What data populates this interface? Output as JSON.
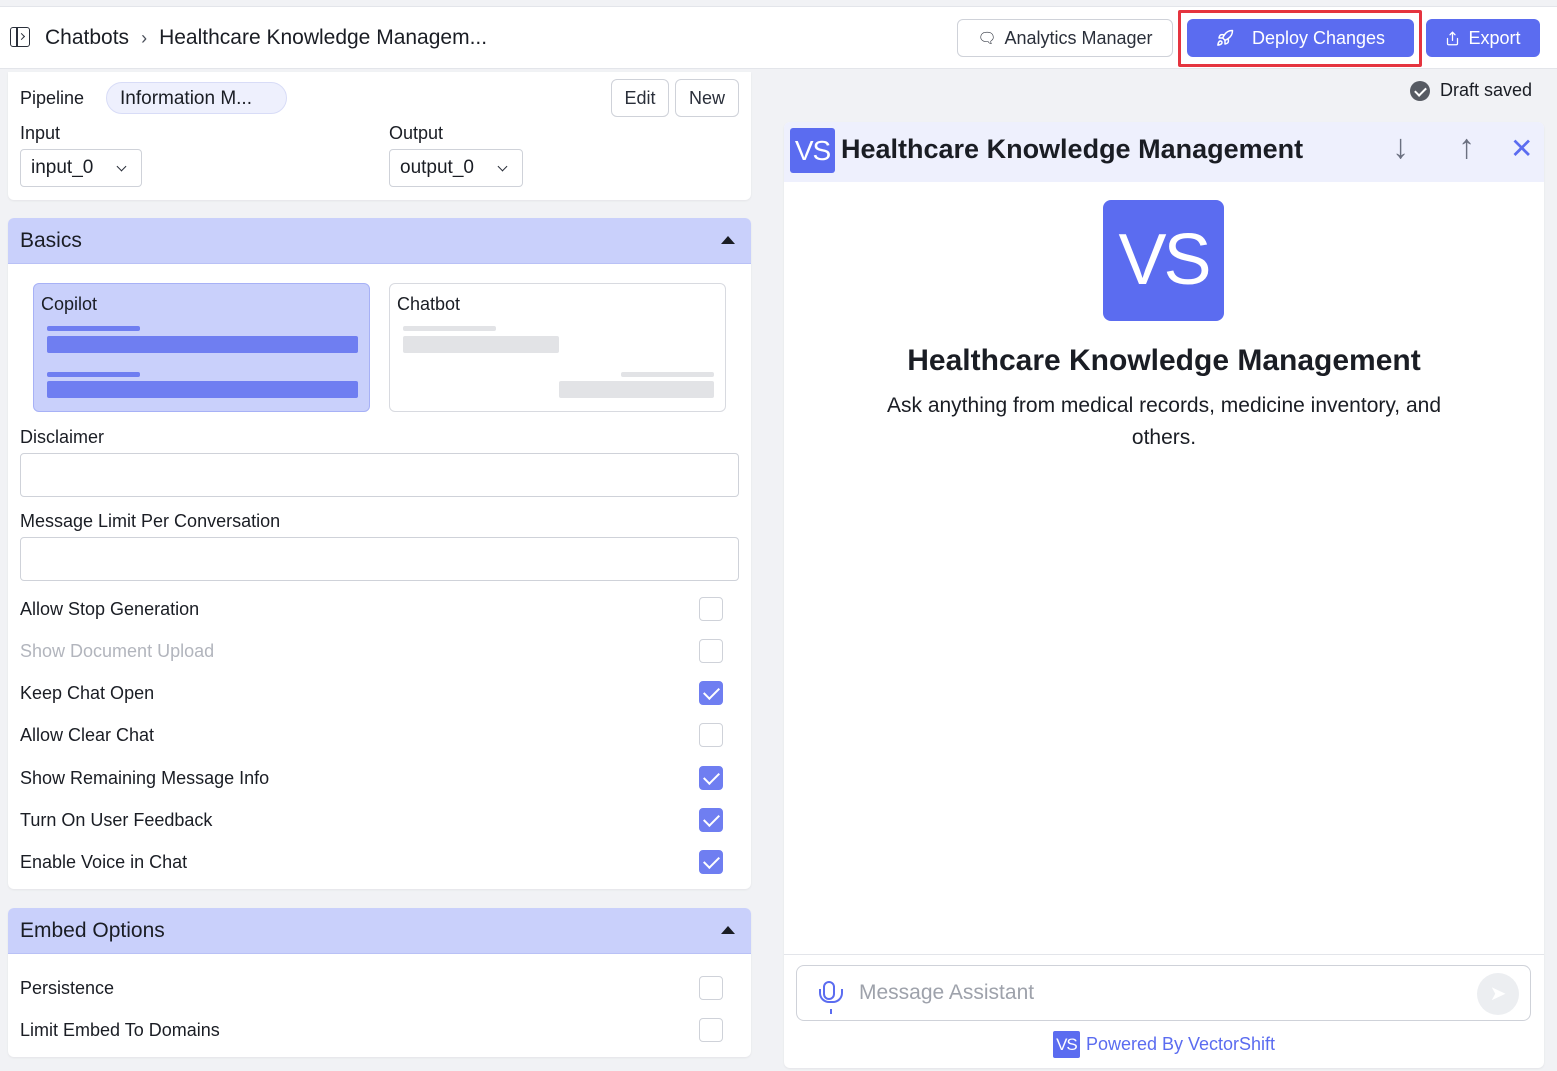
{
  "header": {
    "breadcrumb_root": "Chatbots",
    "breadcrumb_separator": "›",
    "breadcrumb_current": "Healthcare Knowledge Managem...",
    "analytics_label": "Analytics Manager",
    "deploy_label": "Deploy Changes",
    "export_label": "Export"
  },
  "pipeline": {
    "label": "Pipeline",
    "value": "Information M...",
    "edit_label": "Edit",
    "new_label": "New",
    "input_label": "Input",
    "input_value": "input_0",
    "output_label": "Output",
    "output_value": "output_0"
  },
  "basics": {
    "title": "Basics",
    "modes": [
      {
        "label": "Copilot",
        "selected": true
      },
      {
        "label": "Chatbot",
        "selected": false
      }
    ],
    "disclaimer_label": "Disclaimer",
    "disclaimer_value": "",
    "message_limit_label": "Message Limit Per Conversation",
    "message_limit_value": "",
    "options": [
      {
        "label": "Allow Stop Generation",
        "checked": false,
        "disabled": false
      },
      {
        "label": "Show Document Upload",
        "checked": false,
        "disabled": true
      },
      {
        "label": "Keep Chat Open",
        "checked": true,
        "disabled": false
      },
      {
        "label": "Allow Clear Chat",
        "checked": false,
        "disabled": false
      },
      {
        "label": "Show Remaining Message Info",
        "checked": true,
        "disabled": false
      },
      {
        "label": "Turn On User Feedback",
        "checked": true,
        "disabled": false
      },
      {
        "label": "Enable Voice in Chat",
        "checked": true,
        "disabled": false
      }
    ]
  },
  "embed": {
    "title": "Embed Options",
    "options": [
      {
        "label": "Persistence",
        "checked": false
      },
      {
        "label": "Limit Embed To Domains",
        "checked": false
      }
    ]
  },
  "status": {
    "draft_text": "Draft saved"
  },
  "chat": {
    "logo_text": "VS",
    "title": "Healthcare Knowledge Management",
    "welcome_title": "Healthcare Knowledge Management",
    "welcome_subtitle": "Ask anything from medical records, medicine inventory, and others.",
    "message_placeholder": "Message Assistant",
    "powered_by": "Powered By VectorShift"
  },
  "colors": {
    "accent": "#5b6cf0",
    "section_header": "#c9d0fb",
    "highlight_border": "#e5343f",
    "checkbox_on": "#6f7ef1"
  },
  "icons": {
    "sidebar_toggle": "sidebar-toggle-icon",
    "analytics": "chat-bubbles-icon",
    "deploy": "rocket-icon",
    "export": "share-icon",
    "draft": "check-circle-icon",
    "collapse": "caret-up-icon",
    "scroll_down": "arrow-down-icon",
    "scroll_up": "arrow-up-icon",
    "close": "close-icon",
    "mic": "microphone-icon",
    "send": "send-icon"
  }
}
